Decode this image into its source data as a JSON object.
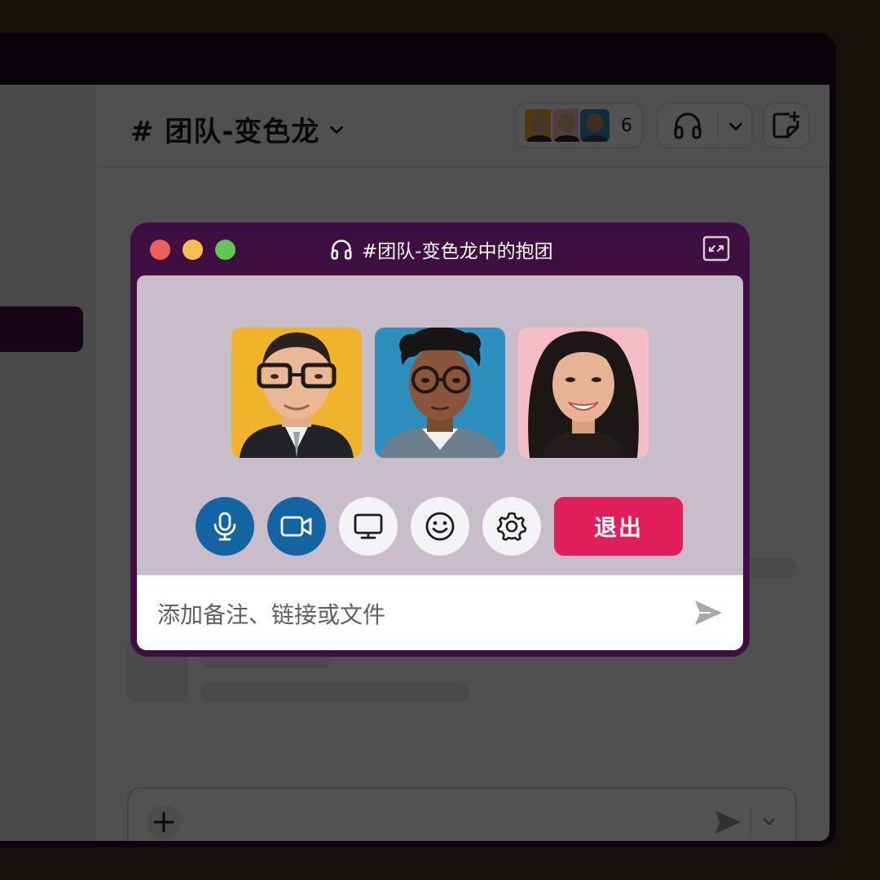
{
  "channel": {
    "title": "# 团队-变色龙",
    "member_count": "6"
  },
  "huddle": {
    "title": "#团队-变色龙中的抱团",
    "participants": [
      {
        "name": "participant-1",
        "bg": "#f0b42c"
      },
      {
        "name": "participant-2",
        "bg": "#2e8fbf"
      },
      {
        "name": "participant-3",
        "bg": "#f5bdc6"
      }
    ],
    "controls": {
      "mic": "microphone-icon",
      "video": "video-camera-icon",
      "screen": "screen-share-icon",
      "emoji": "emoji-icon",
      "settings": "gear-icon",
      "leave_label": "退出"
    },
    "input_placeholder": "添加备注、链接或文件"
  },
  "colors": {
    "aubergine": "#3f0e40",
    "huddle_body": "#c9bccb",
    "active_blue": "#1264a3",
    "leave_red": "#e01e5a",
    "backdrop": "#433724"
  }
}
